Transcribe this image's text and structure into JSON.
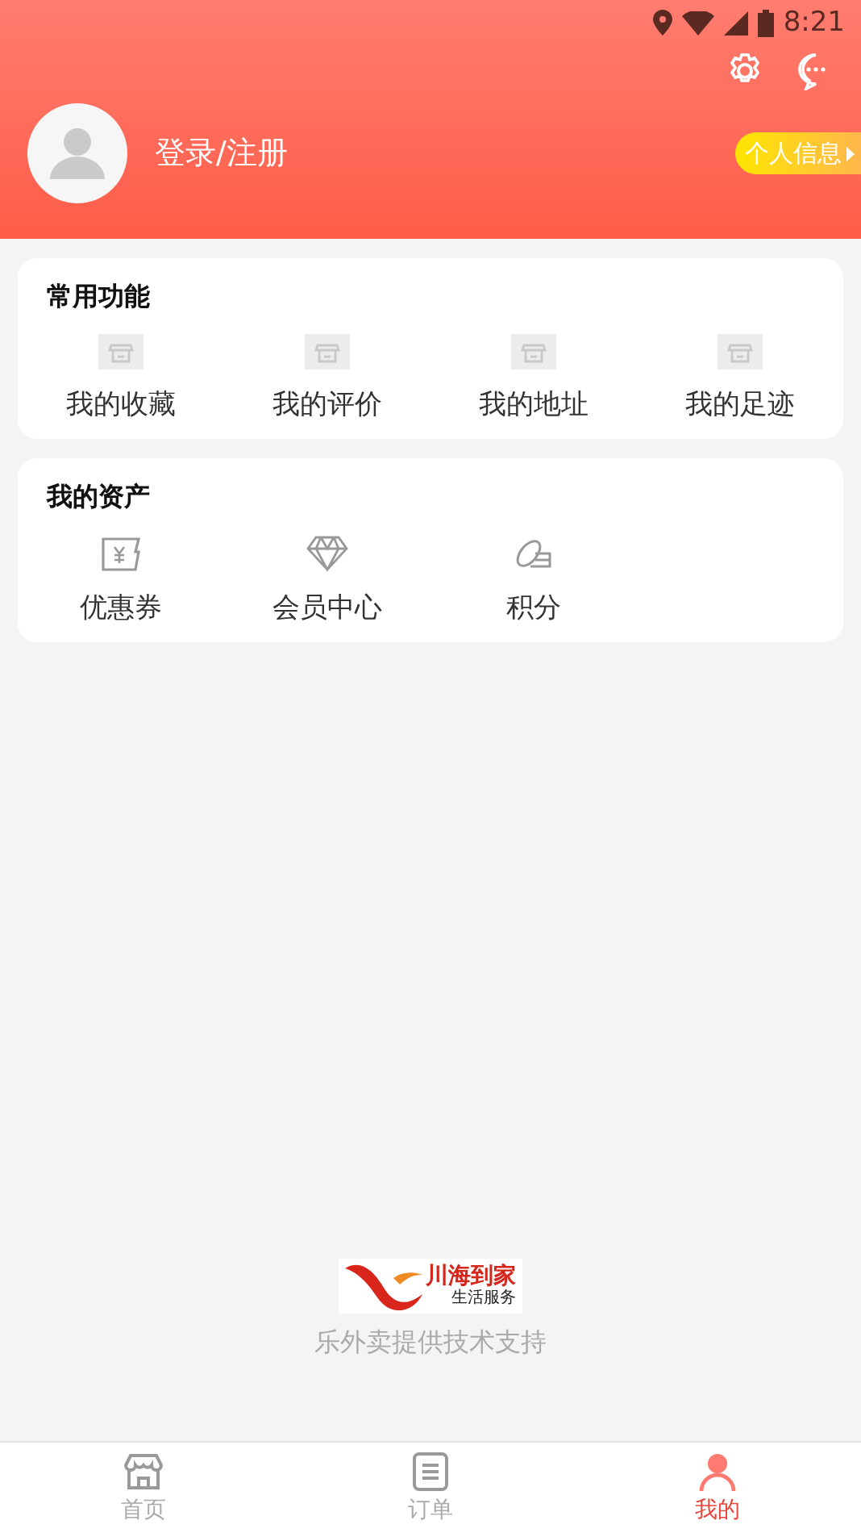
{
  "status_bar": {
    "time": "8:21"
  },
  "profile": {
    "login_label": "登录/注册",
    "info_button": "个人信息"
  },
  "sections": [
    {
      "title": "常用功能",
      "items": [
        {
          "label": "我的收藏",
          "kind": "shop"
        },
        {
          "label": "我的评价",
          "kind": "shop"
        },
        {
          "label": "我的地址",
          "kind": "shop"
        },
        {
          "label": "我的足迹",
          "kind": "shop"
        }
      ]
    },
    {
      "title": "我的资产",
      "items": [
        {
          "label": "优惠券",
          "kind": "coupon"
        },
        {
          "label": "会员中心",
          "kind": "diamond"
        },
        {
          "label": "积分",
          "kind": "coins"
        }
      ]
    }
  ],
  "footer": {
    "logo_title": "川海到家",
    "logo_subtitle": "生活服务",
    "support_text": "乐外卖提供技术支持"
  },
  "tab_bar": [
    {
      "label": "首页",
      "kind": "home",
      "selected": false
    },
    {
      "label": "订单",
      "kind": "orders",
      "selected": false
    },
    {
      "label": "我的",
      "kind": "profile",
      "selected": true
    }
  ]
}
